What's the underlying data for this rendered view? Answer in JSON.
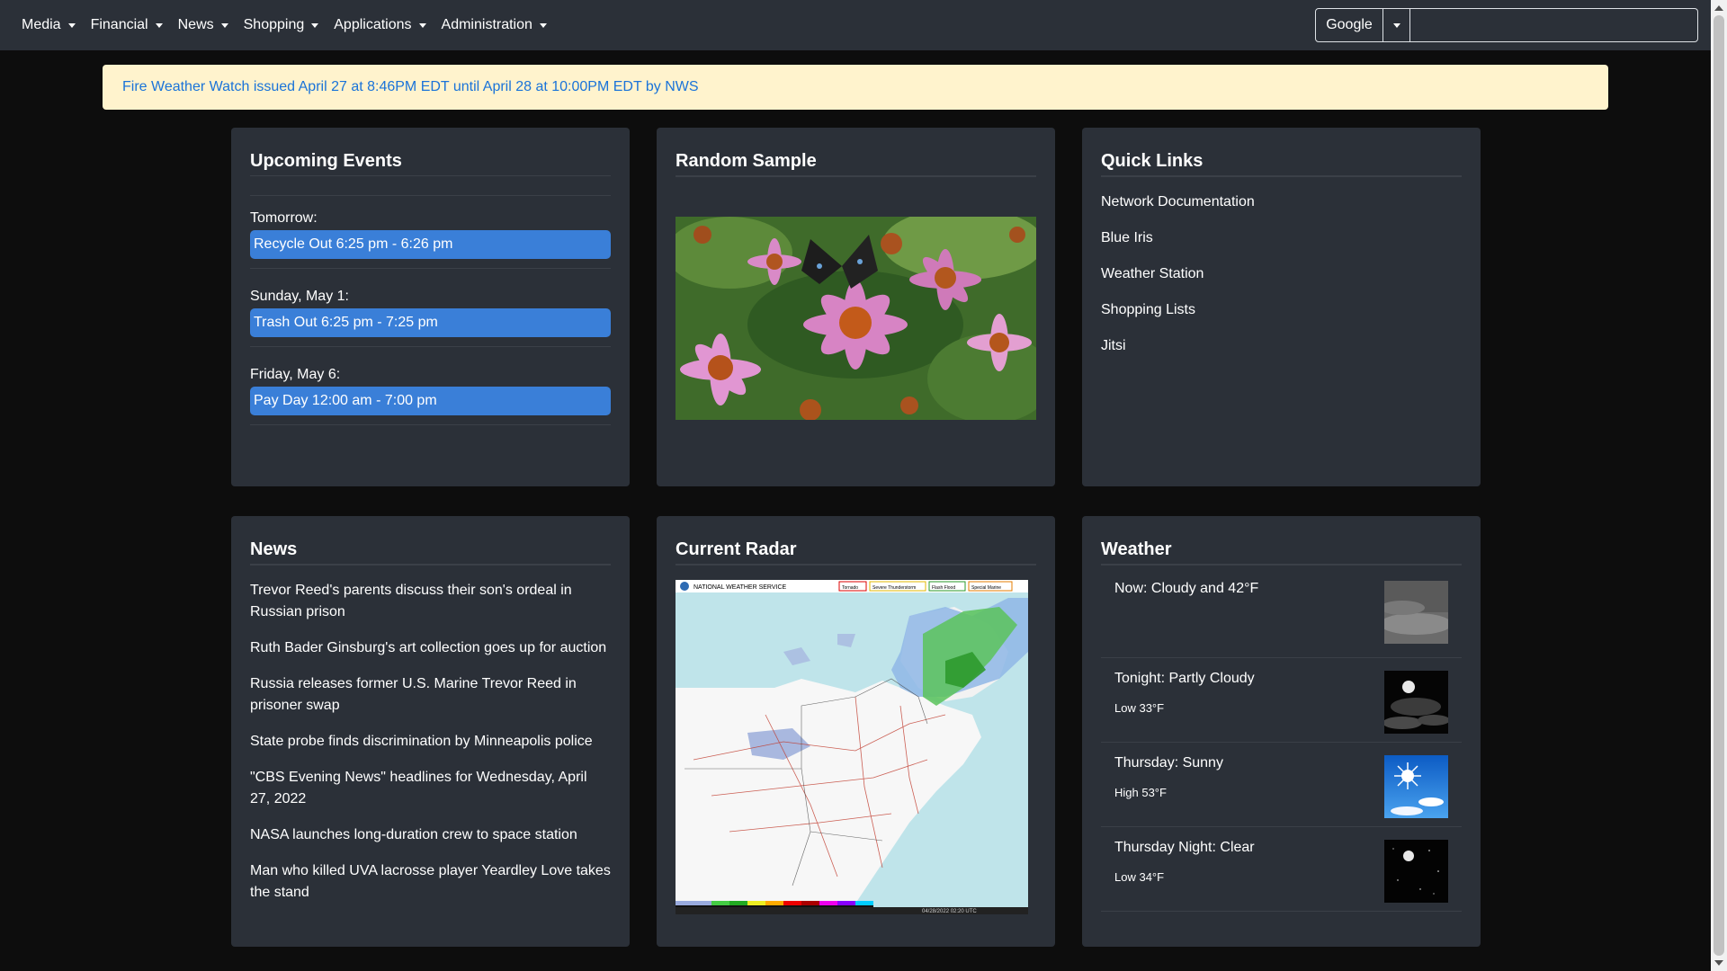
{
  "nav": {
    "items": [
      {
        "label": "Media"
      },
      {
        "label": "Financial"
      },
      {
        "label": "News"
      },
      {
        "label": "Shopping"
      },
      {
        "label": "Applications"
      },
      {
        "label": "Administration"
      }
    ]
  },
  "search": {
    "engine": "Google",
    "value": "",
    "placeholder": ""
  },
  "alert": {
    "text": "Fire Weather Watch issued April 27 at 8:46PM EDT until April 28 at 10:00PM EDT by NWS"
  },
  "events": {
    "title": "Upcoming Events",
    "items": [
      {
        "day": "Tomorrow:",
        "event": "Recycle Out 6:25 pm - 6:26 pm"
      },
      {
        "day": "Sunday, May 1:",
        "event": "Trash Out 6:25 pm - 7:25 pm"
      },
      {
        "day": "Friday, May 6:",
        "event": "Pay Day 12:00 am - 7:00 pm"
      }
    ]
  },
  "sample": {
    "title": "Random Sample"
  },
  "quicklinks": {
    "title": "Quick Links",
    "items": [
      "Network Documentation",
      "Blue Iris",
      "Weather Station",
      "Shopping Lists",
      "Jitsi"
    ]
  },
  "news": {
    "title": "News",
    "items": [
      "Trevor Reed's parents discuss their son's ordeal in Russian prison",
      "Ruth Bader Ginsburg's art collection goes up for auction",
      "Russia releases former U.S. Marine Trevor Reed in prisoner swap",
      "State probe finds discrimination by Minneapolis police",
      "\"CBS Evening News\" headlines for Wednesday, April 27, 2022",
      "NASA launches long-duration crew to space station",
      "Man who killed UVA lacrosse player Yeardley Love takes the stand"
    ]
  },
  "radar": {
    "title": "Current Radar",
    "header": "NATIONAL WEATHER SERVICE",
    "legend": [
      "Tornado",
      "Severe Thunderstorm",
      "Flash Flood",
      "Special Marine"
    ],
    "timestamp": "04/28/2022 02:20 UTC"
  },
  "weather": {
    "title": "Weather",
    "items": [
      {
        "main": "Now: Cloudy and 42°F",
        "sub": "",
        "icon": "cloudy-icon"
      },
      {
        "main": "Tonight: Partly Cloudy",
        "sub": "Low 33°F",
        "icon": "partly-cloudy-night-icon"
      },
      {
        "main": "Thursday: Sunny",
        "sub": "High 53°F",
        "icon": "sunny-icon"
      },
      {
        "main": "Thursday Night: Clear",
        "sub": "Low 34°F",
        "icon": "clear-night-icon"
      }
    ]
  },
  "colors": {
    "navbar": "#2b3038",
    "card": "#2b3038",
    "accent": "#3a7fd8",
    "alert_bg": "#fff3cd",
    "alert_text": "#1a73d9"
  }
}
